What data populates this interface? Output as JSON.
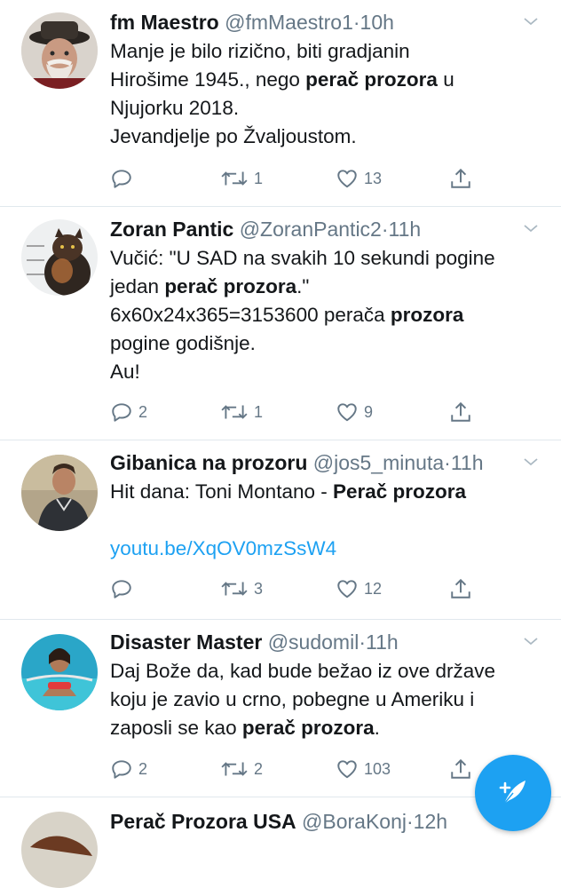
{
  "tweets": [
    {
      "name": "fm Maestro",
      "handle": "@fmMaestro1",
      "dot": "·",
      "time": "10h",
      "lines": [
        {
          "a": "Manje je bilo rizično, biti gradjanin"
        },
        {
          "a": "Hirošime 1945., nego ",
          "b": "perač prozora",
          "c": " u"
        },
        {
          "a": "Njujorku 2018."
        },
        {
          "a": "Jevandjelje po Žvaljoustom."
        }
      ],
      "replies": "",
      "retweets": "1",
      "likes": "13"
    },
    {
      "name": "Zoran Pantic",
      "handle": "@ZoranPantic2",
      "dot": "·",
      "time": "11h",
      "lines": [
        {
          "a": "Vučić: \"U SAD na svakih 10 sekundi pogine"
        },
        {
          "a": "jedan ",
          "b": "perač prozora",
          "c": ".\""
        },
        {
          "a": "6x60x24x365=3153600 perača ",
          "b": "prozora"
        },
        {
          "a": "pogine godišnje."
        },
        {
          "a": "Au!"
        }
      ],
      "replies": "2",
      "retweets": "1",
      "likes": "9"
    },
    {
      "name": "Gibanica na prozoru",
      "handle": "@jos5_minuta",
      "dot": "·",
      "time": "11h",
      "lines": [
        {
          "a": "Hit dana: Toni Montano - ",
          "b": "Perač prozora"
        }
      ],
      "link": "youtu.be/XqOV0mzSsW4",
      "replies": "",
      "retweets": "3",
      "likes": "12"
    },
    {
      "name": "Disaster Master",
      "handle": "@sudomil",
      "dot": "·",
      "time": "11h",
      "lines": [
        {
          "a": "Daj Bože da, kad bude bežao iz ove države"
        },
        {
          "a": "koju je zavio u crno, pobegne u Ameriku i"
        },
        {
          "a": "zaposli se kao ",
          "b": "perač prozora",
          "c": "."
        }
      ],
      "replies": "2",
      "retweets": "2",
      "likes": "103"
    },
    {
      "name": "Perač Prozora USA",
      "handle": "@BoraKonj",
      "dot": "·",
      "time": "12h"
    }
  ],
  "icons": {
    "reply": "reply-icon",
    "retweet": "retweet-icon",
    "like": "heart-icon",
    "share": "share-icon",
    "caret": "chevron-down-icon",
    "compose": "compose-tweet-icon"
  },
  "colors": {
    "accent": "#1da1f2",
    "text": "#14171a",
    "secondary": "#657786",
    "divider": "#e1e8ed"
  }
}
